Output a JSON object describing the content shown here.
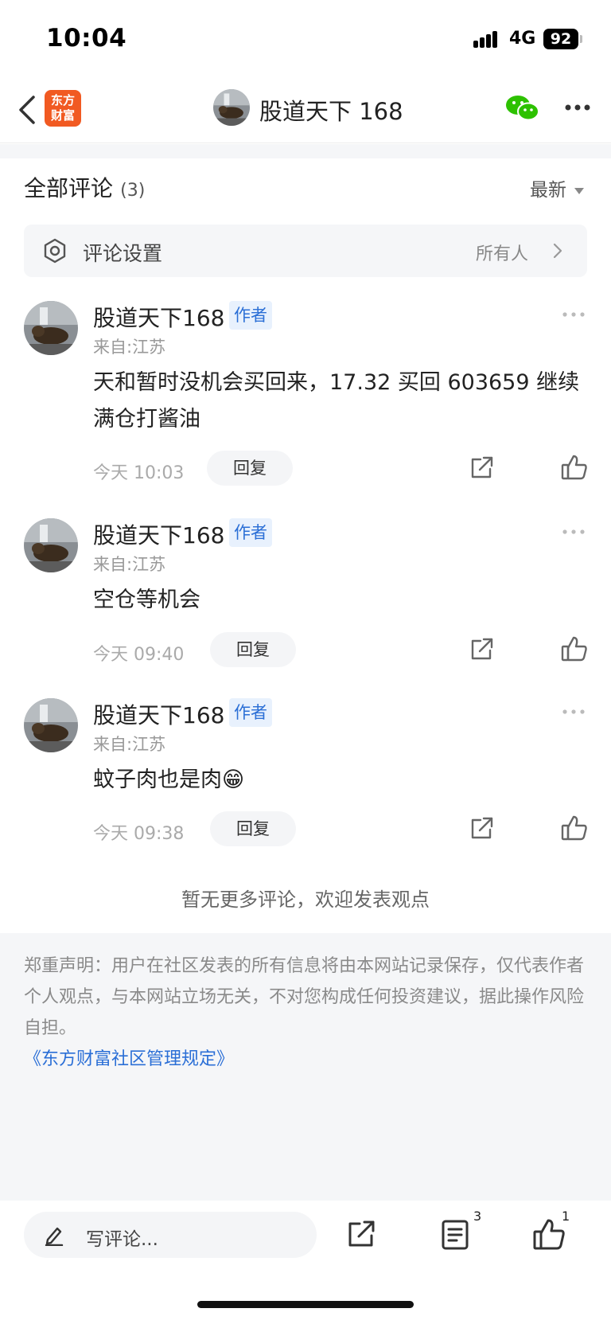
{
  "status_bar": {
    "time": "10:04",
    "network": "4G",
    "battery": "92"
  },
  "nav": {
    "logo_line1": "东方",
    "logo_line2": "财富",
    "title": "股道天下 168"
  },
  "comments_header": {
    "title": "全部评论",
    "count": "(3)",
    "sort_label": "最新"
  },
  "settings": {
    "label": "评论设置",
    "value": "所有人"
  },
  "comments": [
    {
      "author": "股道天下168",
      "badge": "作者",
      "location": "来自:江苏",
      "text": "天和暂时没机会买回来，17.32 买回 603659 继续满仓打酱油",
      "time": "今天 10:03",
      "reply_label": "回复"
    },
    {
      "author": "股道天下168",
      "badge": "作者",
      "location": "来自:江苏",
      "text": "空仓等机会",
      "time": "今天 09:40",
      "reply_label": "回复"
    },
    {
      "author": "股道天下168",
      "badge": "作者",
      "location": "来自:江苏",
      "text": "蚊子肉也是肉😁",
      "time": "今天 09:38",
      "reply_label": "回复"
    }
  ],
  "no_more_text": "暂无更多评论，欢迎发表观点",
  "disclaimer": {
    "text": "郑重声明：用户在社区发表的所有信息将由本网站记录保存，仅代表作者个人观点，与本网站立场无关，不对您构成任何投资建议，据此操作风险自担。",
    "link": "《东方财富社区管理规定》"
  },
  "bottom_bar": {
    "comment_placeholder": "写评论...",
    "comment_count": "3",
    "like_count": "1"
  },
  "colors": {
    "brand_orange": "#f15a22",
    "link_blue": "#2b6fd6",
    "wechat_green": "#2dc100"
  }
}
